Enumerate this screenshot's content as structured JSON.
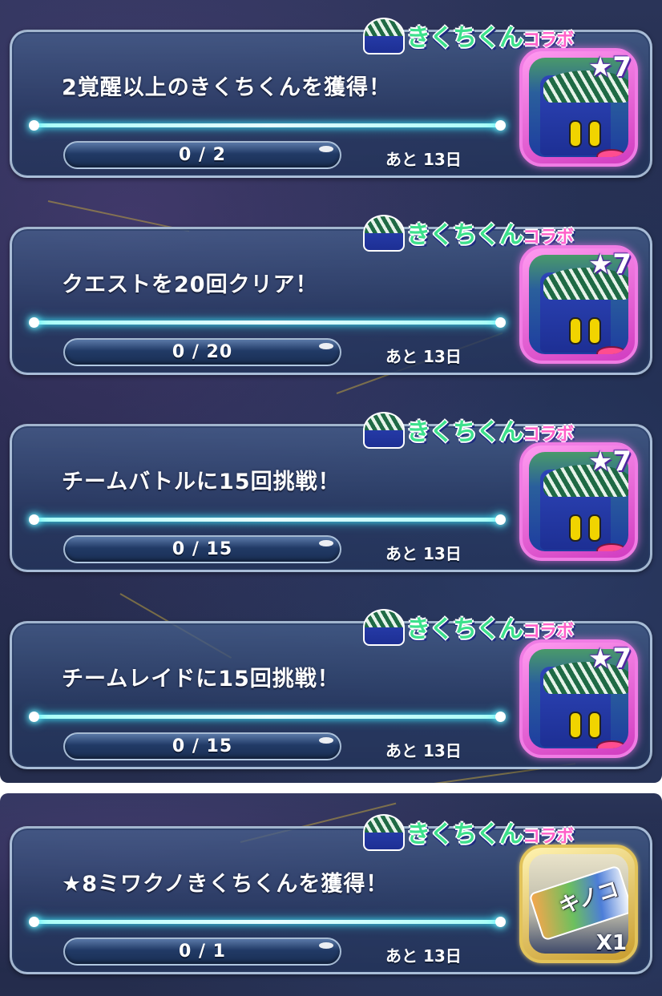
{
  "missions_group_a": [
    {
      "title": "2覚醒以上のきくちくんを獲得！",
      "progress": "0 / 2",
      "progress_fraction": 0,
      "remaining": "あと 13日",
      "tag": "きくちくん",
      "tag_suffix": "コラボ",
      "reward_rarity": "★7"
    },
    {
      "title": "クエストを20回クリア！",
      "progress": "0 / 20",
      "progress_fraction": 0,
      "remaining": "あと 13日",
      "tag": "きくちくん",
      "tag_suffix": "コラボ",
      "reward_rarity": "★7"
    },
    {
      "title": "チームバトルに15回挑戦！",
      "progress": "0 / 15",
      "progress_fraction": 0,
      "remaining": "あと 13日",
      "tag": "きくちくん",
      "tag_suffix": "コラボ",
      "reward_rarity": "★7"
    },
    {
      "title": "チームレイドに15回挑戦！",
      "progress": "0 / 15",
      "progress_fraction": 0,
      "remaining": "あと 13日",
      "tag": "きくちくん",
      "tag_suffix": "コラボ",
      "reward_rarity": "★7"
    }
  ],
  "missions_group_b": [
    {
      "title": "★8ミワクノきくちくんを獲得！",
      "progress": "0 / 1",
      "progress_fraction": 0,
      "remaining": "あと 13日",
      "tag": "きくちくん",
      "tag_suffix": "コラボ",
      "reward_item": "キノコ",
      "reward_qty": "X1"
    }
  ],
  "colors": {
    "glow": "#40e8ff",
    "reward_border": "#f07ce4",
    "gold_border": "#e2c35a",
    "tag_green": "#3de08c"
  }
}
